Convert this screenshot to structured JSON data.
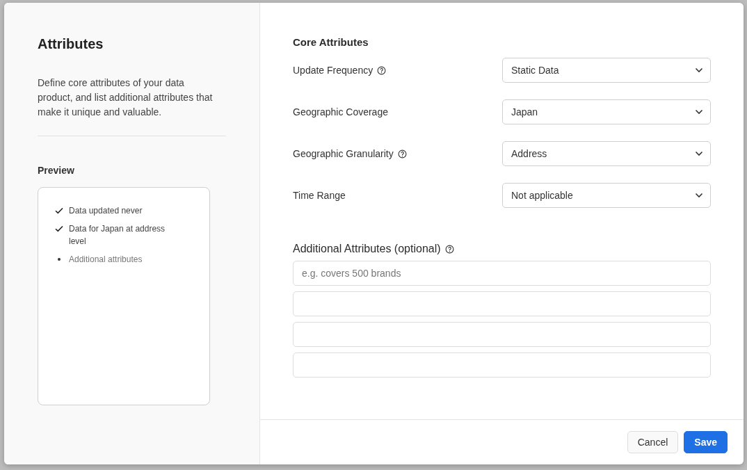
{
  "dialog": {
    "title": "Attributes",
    "description": "Define core attributes of your data product, and list additional attributes that make it unique and valuable.",
    "preview": {
      "heading": "Preview",
      "items": [
        {
          "kind": "check",
          "text": "Data updated never"
        },
        {
          "kind": "check",
          "text": "Data for Japan at address level"
        },
        {
          "kind": "bullet",
          "text": "Additional attributes"
        }
      ]
    },
    "core": {
      "heading": "Core Attributes",
      "fields": [
        {
          "label": "Update Frequency",
          "help": true,
          "value": "Static Data"
        },
        {
          "label": "Geographic Coverage",
          "help": false,
          "value": "Japan"
        },
        {
          "label": "Geographic Granularity",
          "help": true,
          "value": "Address"
        },
        {
          "label": "Time Range",
          "help": false,
          "value": "Not applicable"
        }
      ]
    },
    "additional": {
      "heading": "Additional Attributes (optional)",
      "help": true,
      "fields": [
        {
          "kind": "text",
          "placeholder": "e.g. covers 500 brands"
        },
        {
          "kind": "text"
        },
        {
          "kind": "text"
        },
        {
          "kind": "text"
        }
      ]
    },
    "buttons": [
      {
        "kind": "secondary",
        "label": "Cancel"
      },
      {
        "kind": "primary",
        "label": "Save"
      }
    ]
  }
}
